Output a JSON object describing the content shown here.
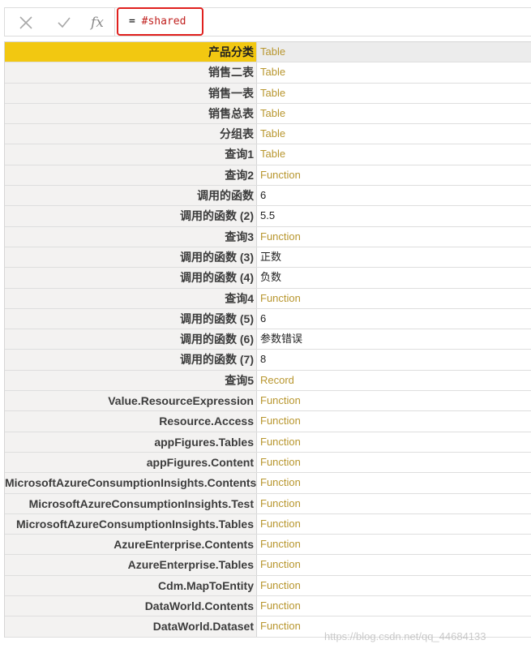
{
  "formula_bar": {
    "cancel_icon": "close-icon",
    "commit_icon": "check-icon",
    "fx_label": "fx",
    "prefix": "= ",
    "expression": "#shared"
  },
  "colors": {
    "selected_row": "#f2c811",
    "link_value": "#b8962e",
    "highlight_border": "#e0201e"
  },
  "rows": [
    {
      "name": "产品分类",
      "value": "Table",
      "kind": "link",
      "selected": true
    },
    {
      "name": "销售二表",
      "value": "Table",
      "kind": "link"
    },
    {
      "name": "销售一表",
      "value": "Table",
      "kind": "link"
    },
    {
      "name": "销售总表",
      "value": "Table",
      "kind": "link"
    },
    {
      "name": "分组表",
      "value": "Table",
      "kind": "link"
    },
    {
      "name": "查询1",
      "value": "Table",
      "kind": "link"
    },
    {
      "name": "查询2",
      "value": "Function",
      "kind": "link"
    },
    {
      "name": "调用的函数",
      "value": "6",
      "kind": "plain"
    },
    {
      "name": "调用的函数 (2)",
      "value": "5.5",
      "kind": "plain"
    },
    {
      "name": "查询3",
      "value": "Function",
      "kind": "link"
    },
    {
      "name": "调用的函数 (3)",
      "value": "正数",
      "kind": "plain"
    },
    {
      "name": "调用的函数 (4)",
      "value": "负数",
      "kind": "plain"
    },
    {
      "name": "查询4",
      "value": "Function",
      "kind": "link"
    },
    {
      "name": "调用的函数 (5)",
      "value": "6",
      "kind": "plain"
    },
    {
      "name": "调用的函数 (6)",
      "value": "参数错误",
      "kind": "plain"
    },
    {
      "name": "调用的函数 (7)",
      "value": "8",
      "kind": "plain"
    },
    {
      "name": "查询5",
      "value": "Record",
      "kind": "link"
    },
    {
      "name": "Value.ResourceExpression",
      "value": "Function",
      "kind": "link"
    },
    {
      "name": "Resource.Access",
      "value": "Function",
      "kind": "link"
    },
    {
      "name": "appFigures.Tables",
      "value": "Function",
      "kind": "link"
    },
    {
      "name": "appFigures.Content",
      "value": "Function",
      "kind": "link"
    },
    {
      "name": "MicrosoftAzureConsumptionInsights.Contents",
      "value": "Function",
      "kind": "link"
    },
    {
      "name": "MicrosoftAzureConsumptionInsights.Test",
      "value": "Function",
      "kind": "link"
    },
    {
      "name": "MicrosoftAzureConsumptionInsights.Tables",
      "value": "Function",
      "kind": "link"
    },
    {
      "name": "AzureEnterprise.Contents",
      "value": "Function",
      "kind": "link"
    },
    {
      "name": "AzureEnterprise.Tables",
      "value": "Function",
      "kind": "link"
    },
    {
      "name": "Cdm.MapToEntity",
      "value": "Function",
      "kind": "link"
    },
    {
      "name": "DataWorld.Contents",
      "value": "Function",
      "kind": "link"
    },
    {
      "name": "DataWorld.Dataset",
      "value": "Function",
      "kind": "link"
    }
  ],
  "watermark": "https://blog.csdn.net/qq_44684133"
}
